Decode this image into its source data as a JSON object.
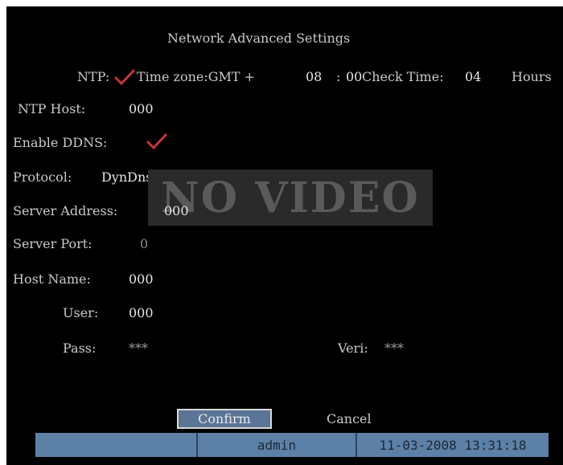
{
  "title": "Network Advanced Settings",
  "ntp": {
    "label": "NTP:",
    "checked": true,
    "timezone_label": "Time zone:GMT +",
    "timezone_hours": "08",
    "timezone_sep": ":",
    "timezone_minutes": "00",
    "check_time_label": "Check Time:",
    "check_time_value": "04",
    "check_time_unit": "Hours"
  },
  "ntp_host": {
    "label": "NTP Host:",
    "value": "000"
  },
  "enable_ddns": {
    "label": "Enable DDNS:",
    "checked": true
  },
  "protocol": {
    "label": "Protocol:",
    "value": "DynDns"
  },
  "server_address": {
    "label": "Server Address:",
    "value": "000"
  },
  "server_port": {
    "label": "Server Port:",
    "value": "0"
  },
  "host_name": {
    "label": "Host Name:",
    "value": "000"
  },
  "user": {
    "label": "User:",
    "value": "000"
  },
  "pass": {
    "label": "Pass:",
    "value": "***"
  },
  "veri": {
    "label": "Veri:",
    "value": "***"
  },
  "overlay": {
    "text": "NO VIDEO"
  },
  "buttons": {
    "confirm": "Confirm",
    "cancel": "Cancel"
  },
  "status_bar": {
    "user": "admin",
    "datetime": "11-03-2008 13:31:18"
  },
  "colors": {
    "background": "#000000",
    "checkmark": "#c8343a",
    "confirm_bg": "#5b7597",
    "status_bar": "#5d80a6"
  }
}
